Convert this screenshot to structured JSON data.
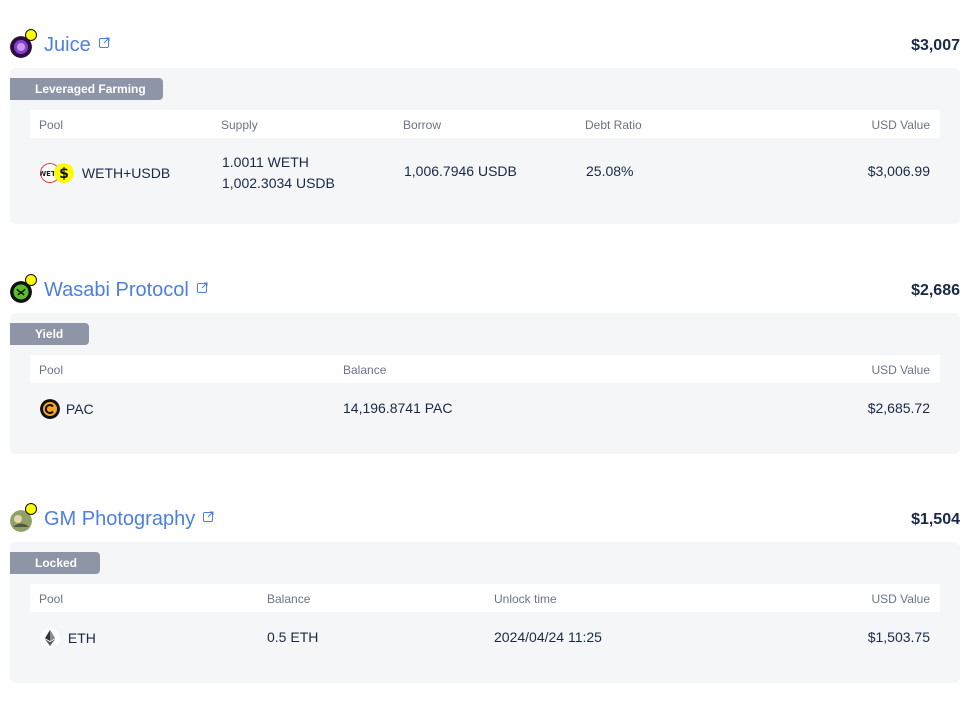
{
  "protocols": [
    {
      "name": "Juice",
      "total": "$3,007",
      "tag": "Leveraged Farming",
      "columns": [
        "Pool",
        "Supply",
        "Borrow",
        "Debt Ratio",
        "USD Value"
      ],
      "rows": [
        {
          "pool": "WETH+USDB",
          "supply_line1": "1.0011 WETH",
          "supply_line2": "1,002.3034 USDB",
          "borrow": "1,006.7946 USDB",
          "debt_ratio": "25.08%",
          "usd_value": "$3,006.99",
          "icons": [
            "weth-icon",
            "usdb-icon"
          ]
        }
      ]
    },
    {
      "name": "Wasabi Protocol",
      "total": "$2,686",
      "tag": "Yield",
      "columns": [
        "Pool",
        "Balance",
        "USD Value"
      ],
      "rows": [
        {
          "pool": "PAC",
          "balance": "14,196.8741 PAC",
          "usd_value": "$2,685.72",
          "icons": [
            "pac-icon"
          ]
        }
      ]
    },
    {
      "name": "GM Photography",
      "total": "$1,504",
      "tag": "Locked",
      "columns": [
        "Pool",
        "Balance",
        "Unlock time",
        "USD Value"
      ],
      "rows": [
        {
          "pool": "ETH",
          "balance": "0.5 ETH",
          "unlock_time": "2024/04/24 11:25",
          "usd_value": "$1,503.75",
          "icons": [
            "eth-icon"
          ]
        }
      ]
    }
  ],
  "colors": {
    "link": "#4c7fe0",
    "tag_bg": "#8e95a7",
    "card_bg": "#f5f6f8",
    "text": "#192945",
    "muted": "#6b7387",
    "chain_badge": "#fcfc03"
  }
}
